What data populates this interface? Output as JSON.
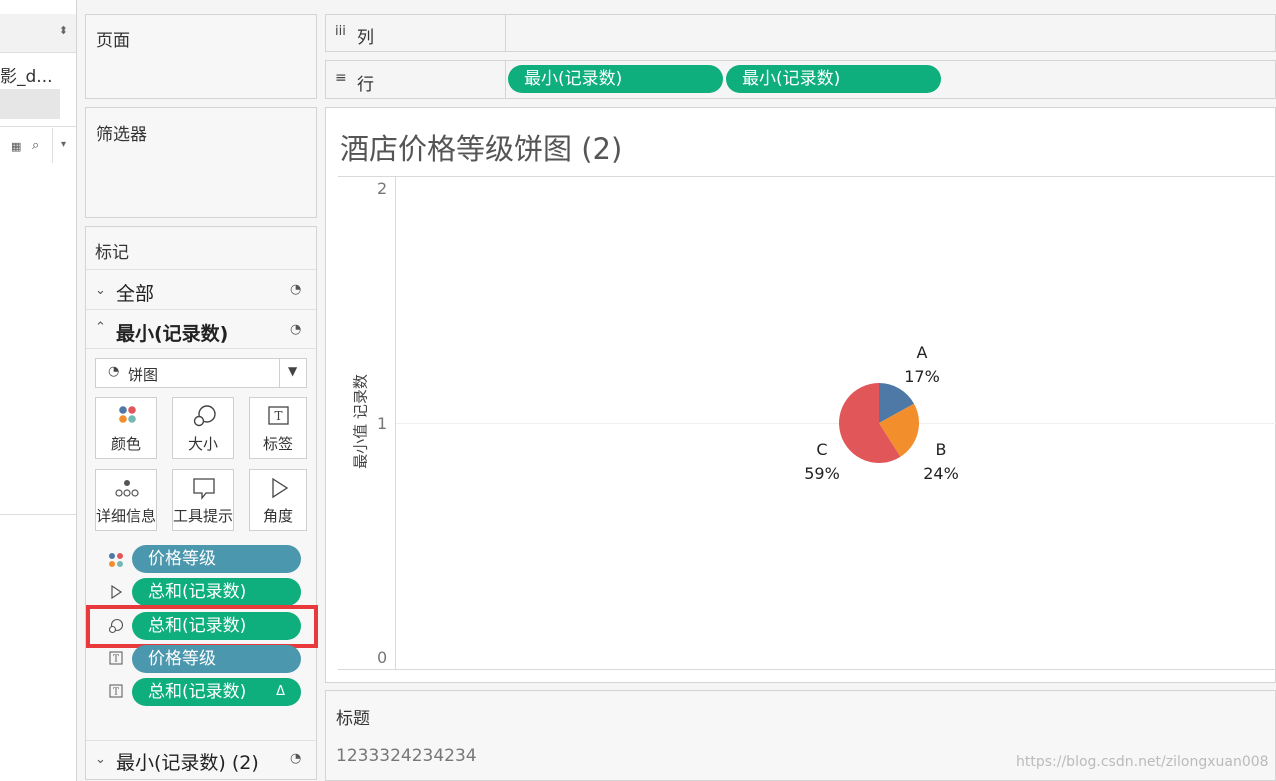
{
  "left_strip": {
    "datasource_text": "影_d...",
    "sort_arrow": "⬍"
  },
  "pages_panel": {
    "title": "页面"
  },
  "filters_panel": {
    "title": "筛选器"
  },
  "marks_panel": {
    "title": "标记",
    "sections": {
      "all": "全部",
      "min_records": "最小(记录数)",
      "min_records_2": "最小(记录数) (2)"
    },
    "mark_type": "饼图",
    "cards": {
      "color": "颜色",
      "size": "大小",
      "label": "标签",
      "detail": "详细信息",
      "tooltip": "工具提示",
      "angle": "角度"
    },
    "fields": [
      {
        "icon": "color-dots-icon",
        "text": "价格等级",
        "color": "#4b97ad"
      },
      {
        "icon": "angle-icon",
        "text": "总和(记录数)",
        "color": "#0eaf7c"
      },
      {
        "icon": "size-icon",
        "text": "总和(记录数)",
        "color": "#0eaf7c"
      },
      {
        "icon": "label-icon",
        "text": "价格等级",
        "color": "#4b97ad"
      },
      {
        "icon": "label-icon",
        "text": "总和(记录数)",
        "color": "#0eaf7c",
        "suffix": "Δ"
      }
    ],
    "highlight_color": "#e8393c"
  },
  "shelves": {
    "columns": {
      "icon": "iii",
      "label": "列"
    },
    "rows": {
      "icon": "≡",
      "label": "行",
      "pills": [
        "最小(记录数)",
        "最小(记录数)"
      ]
    }
  },
  "worksheet": {
    "title": "酒店价格等级饼图 (2)",
    "caption_title": "标题",
    "caption_text": "1233324234234"
  },
  "chart_data": {
    "type": "pie",
    "title": "酒店价格等级饼图 (2)",
    "ylabel": "最小值 记录数",
    "y_ticks": [
      "2",
      "1",
      "0"
    ],
    "ylim": [
      0,
      2
    ],
    "slices": [
      {
        "label": "A",
        "pct_text": "17%",
        "value": 17,
        "color": "#4e79a7"
      },
      {
        "label": "B",
        "pct_text": "24%",
        "value": 24,
        "color": "#f28e2b"
      },
      {
        "label": "C",
        "pct_text": "59%",
        "value": 59,
        "color": "#e15759"
      }
    ]
  },
  "watermark": "https://blog.csdn.net/zilongxuan008"
}
